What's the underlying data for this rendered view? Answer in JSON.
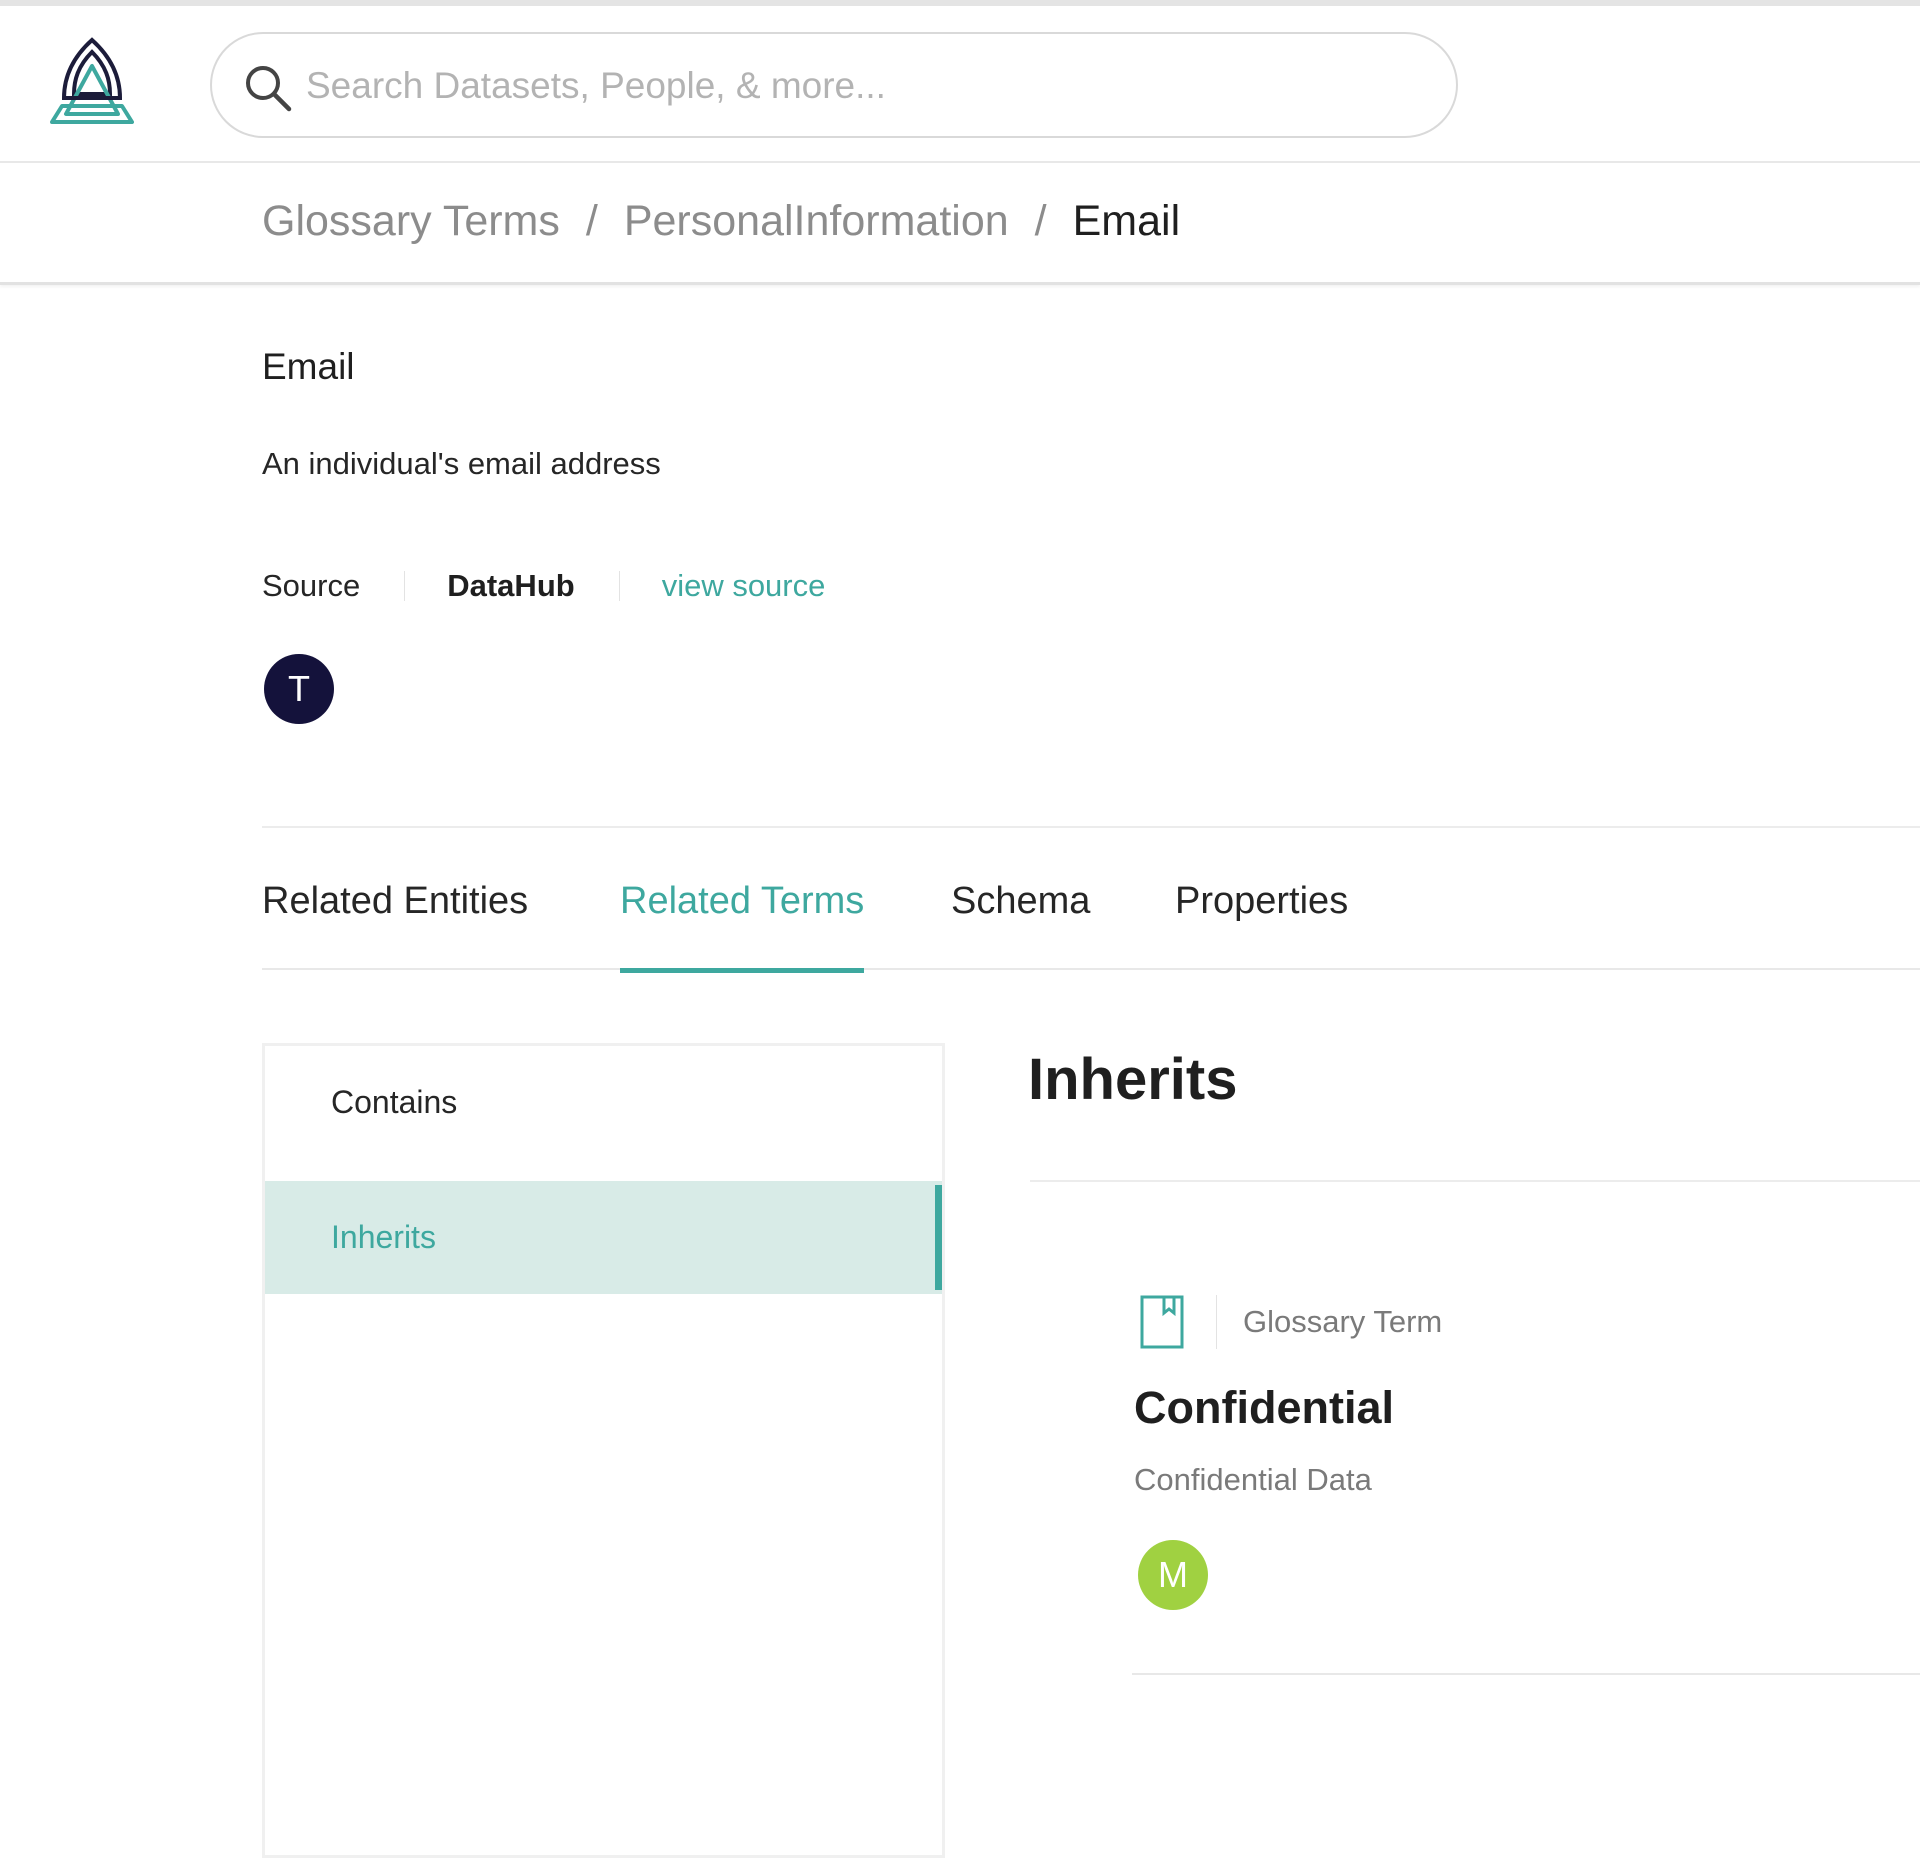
{
  "search": {
    "placeholder": "Search Datasets, People, & more..."
  },
  "breadcrumb": {
    "items": [
      "Glossary Terms",
      "PersonalInformation",
      "Email"
    ],
    "separator": "/"
  },
  "entity": {
    "name": "Email",
    "description": "An individual's email address",
    "source_label": "Source",
    "source_value": "DataHub",
    "view_source_label": "view source",
    "owner_initial": "T"
  },
  "tabs": [
    {
      "label": "Related Entities",
      "active": false
    },
    {
      "label": "Related Terms",
      "active": true
    },
    {
      "label": "Schema",
      "active": false
    },
    {
      "label": "Properties",
      "active": false
    }
  ],
  "side_menu": {
    "items": [
      {
        "label": "Contains",
        "selected": false
      },
      {
        "label": "Inherits",
        "selected": true
      }
    ]
  },
  "related": {
    "section_title": "Inherits",
    "terms": [
      {
        "type_label": "Glossary Term",
        "type_icon": "book-icon",
        "name": "Confidential",
        "description": "Confidential Data",
        "owner_initial": "M"
      }
    ]
  },
  "colors": {
    "accent": "#3ea89f",
    "selected_bg": "#d8ebe7",
    "owner_t": "#14123b",
    "owner_m": "#a0d141"
  }
}
